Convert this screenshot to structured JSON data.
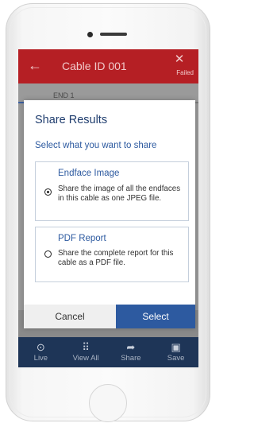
{
  "appbar": {
    "back_icon": "back-arrow-icon",
    "title": "Cable ID 001",
    "close_icon": "close-icon",
    "close_glyph": "✕",
    "status": "Failed"
  },
  "background": {
    "tab_label": "END 1"
  },
  "dialog": {
    "title": "Share Results",
    "subtitle": "Select what you want to share",
    "options": [
      {
        "title": "Endface Image",
        "description": "Share the image of all the endfaces in this cable as one JPEG file.",
        "selected": true
      },
      {
        "title": "PDF Report",
        "description": "Share the complete report for this cable as a PDF file.",
        "selected": false
      }
    ],
    "cancel_label": "Cancel",
    "select_label": "Select"
  },
  "bottom_nav": [
    {
      "label": "Live",
      "icon": "play-circle-icon",
      "glyph": "⊙"
    },
    {
      "label": "View All",
      "icon": "grid-dots-icon",
      "glyph": "⠿"
    },
    {
      "label": "Share",
      "icon": "share-arrow-icon",
      "glyph": "➦"
    },
    {
      "label": "Save",
      "icon": "floppy-disk-icon",
      "glyph": "▣"
    }
  ],
  "colors": {
    "appbar": "#b51f24",
    "accent": "#2d5aa0",
    "bottom_nav": "#1e3557"
  }
}
